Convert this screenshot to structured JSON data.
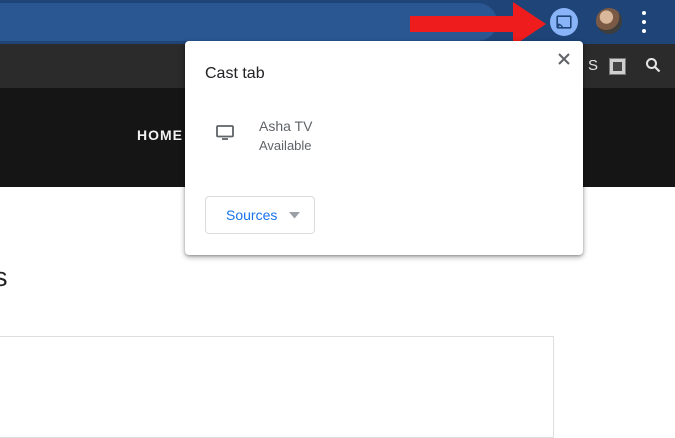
{
  "browser": {
    "toolbar_color": "#1e4478",
    "cast_icon_active_color": "#8ab4f8"
  },
  "annotation": {
    "arrow_color": "#ee1c1c"
  },
  "site": {
    "nav_top_text": "S",
    "home_link": "HOME"
  },
  "page": {
    "heading_partial": "s"
  },
  "cast_dialog": {
    "title": "Cast tab",
    "device": {
      "name": "Asha TV",
      "status": "Available"
    },
    "sources_label": "Sources"
  },
  "icons": [
    "cast-icon",
    "avatar",
    "menu-dots-icon",
    "flag-icon",
    "search-icon",
    "close-icon",
    "tv-icon",
    "dropdown-caret-icon"
  ]
}
